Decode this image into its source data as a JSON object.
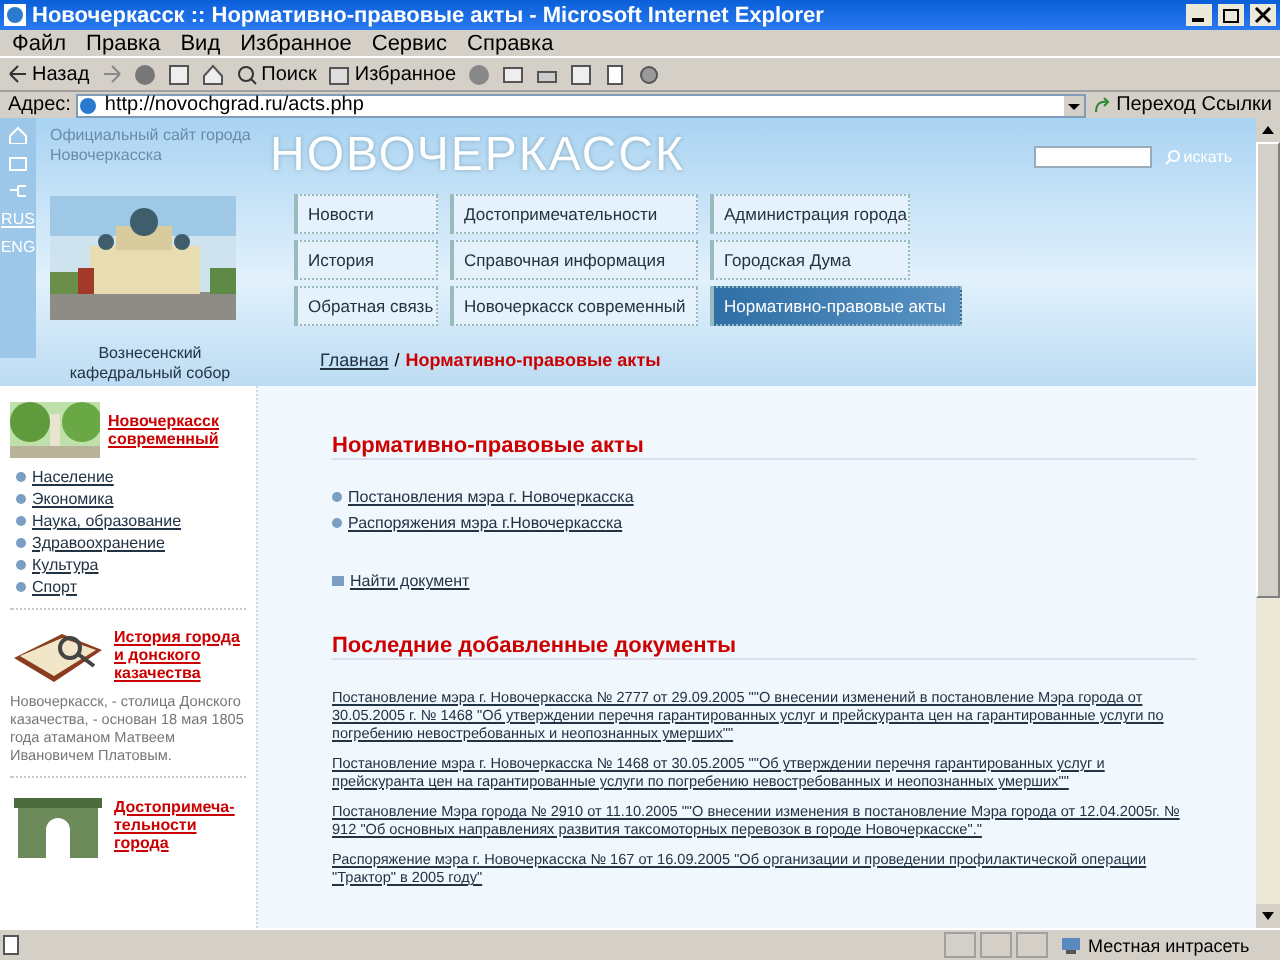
{
  "window": {
    "title": "Новочеркасск :: Нормативно-правовые акты - Microsoft Internet Explorer"
  },
  "menu": [
    "Файл",
    "Правка",
    "Вид",
    "Избранное",
    "Сервис",
    "Справка"
  ],
  "toolbar": {
    "back": "Назад",
    "search": "Поиск",
    "favorites": "Избранное"
  },
  "address": {
    "label": "Адрес:",
    "url": "http://novochgrad.ru/acts.php",
    "go": "Переход",
    "links": "Ссылки"
  },
  "header": {
    "languages": [
      {
        "label": "RUS",
        "selected": true
      },
      {
        "label": "ENG",
        "selected": false
      }
    ],
    "tagline": "Официальный сайт города Новочеркасска",
    "site_title": "НОВОЧЕРКАССК",
    "photo_caption": "Вознесенский кафедральный собор",
    "nav": [
      {
        "label": "Новости",
        "selected": false
      },
      {
        "label": "История",
        "selected": false
      },
      {
        "label": "Обратная связь",
        "selected": false
      },
      {
        "label": "Достопримечательности",
        "selected": false
      },
      {
        "label": "Справочная информация",
        "selected": false
      },
      {
        "label": "Новочеркасск современный",
        "selected": false
      },
      {
        "label": "Администрация города",
        "selected": false
      },
      {
        "label": "Городская Дума",
        "selected": false
      },
      {
        "label": "Нормативно-правовые акты",
        "selected": true
      }
    ],
    "search_button": "искать",
    "breadcrumb": {
      "home": "Главная",
      "separator": "/",
      "current": "Нормативно-правовые акты"
    }
  },
  "sidebar": [
    {
      "kind": "links",
      "title": "Новочеркасск современный",
      "links": [
        "Население",
        "Экономика",
        "Наука, образование",
        "Здравоохранение",
        "Культура",
        "Спорт"
      ]
    },
    {
      "kind": "text",
      "title": "История города и донского казачества",
      "text": "Новочеркасск, - столица Донского казачества, - основан 18 мая 1805 года атаманом Матвеем Ивановичем Платовым."
    },
    {
      "kind": "arch",
      "title": "Достопримеча-тельности города"
    }
  ],
  "main": {
    "heading": "Нормативно-правовые акты",
    "links": [
      "Постановления мэра г. Новочеркасска",
      "Распоряжения мэра г.Новочеркасска"
    ],
    "find": "Найти документ",
    "recent_heading": "Последние добавленные документы",
    "documents": [
      "Постановление мэра г. Новочеркасска № 2777 от 29.09.2005 \"\"О внесении изменений в постановление Мэра города от 30.05.2005 г. № 1468 \"Об утверждении перечня гарантированных услуг и прейскуранта цен на гарантированные услуги по погребению невостребованных и неопознанных умерших\"\"",
      "Постановление мэра г. Новочеркасска № 1468 от 30.05.2005 \"\"Об утверждении перечня гарантированных услуг и прейскуранта цен на гарантированные услуги по погребению невостребованных и неопознанных умерших\"\"",
      "Постановление Мэра города № 2910 от 11.10.2005 \"\"О внесении изменения в постановление Мэра города от 12.04.2005г. № 912 \"Об основных направлениях развития таксомоторных перевозок в городе Новочеркасске\".\"",
      "Распоряжение мэра г. Новочеркасска № 167 от 16.09.2005 \"Об организации и проведении профилактической операции \"Трактор\" в 2005 году\""
    ]
  },
  "status_bar": {
    "zone": "Местная интрасеть"
  }
}
